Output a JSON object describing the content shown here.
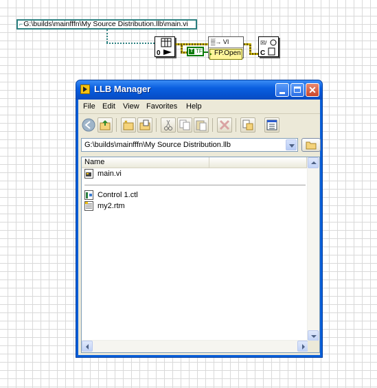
{
  "diagram": {
    "path_prefix": "⌐",
    "path_constant": "G:\\builds\\mainfffn\\My Source Distribution.llb\\main.vi",
    "bool_constant": "T",
    "bool_type": "TF",
    "node_vi_label": "VI",
    "property_node_label": "FP.Open",
    "close_node_label": "C"
  },
  "window": {
    "title": "LLB Manager",
    "menu": [
      "File",
      "Edit",
      "View",
      "Favorites",
      "Help"
    ],
    "toolbar_icons": [
      "back-icon",
      "up-folder-icon",
      "new-folder-icon",
      "copy-to-folder-icon",
      "cut-icon",
      "copy-icon",
      "paste-icon",
      "delete-icon",
      "properties-icon",
      "view-icon"
    ],
    "address": "G:\\builds\\mainfffn\\My Source Distribution.llb",
    "columns": {
      "name": "Name"
    },
    "top_level": [
      {
        "name": "main.vi",
        "icon": "vi-file-icon"
      }
    ],
    "other_files": [
      {
        "name": "Control 1.ctl",
        "icon": "ctl-file-icon"
      },
      {
        "name": "my2.rtm",
        "icon": "rtm-file-icon"
      }
    ],
    "colors": {
      "title_bar": "#0b5fe0",
      "client_bg": "#ece9d8",
      "close_button": "#c9452a",
      "path_wire": "#2a7f7f",
      "bool_const": "#0a7a0a"
    }
  }
}
